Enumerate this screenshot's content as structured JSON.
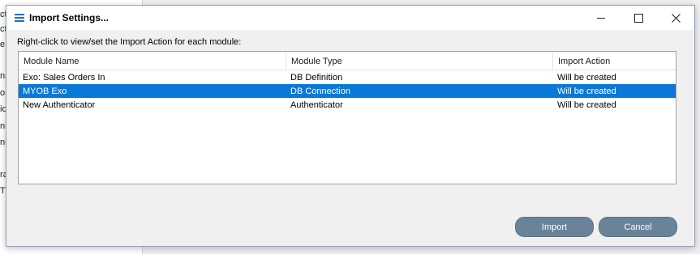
{
  "background": {
    "fragments": [
      "ct",
      "ct",
      "e",
      "ns",
      "or",
      "io",
      "ni",
      "ni",
      "ra",
      "T"
    ]
  },
  "dialog": {
    "title": "Import Settings...",
    "instruction": "Right-click to view/set the Import Action for each module:",
    "columns": [
      "Module Name",
      "Module Type",
      "Import Action"
    ],
    "rows": [
      {
        "name": "Exo: Sales Orders In",
        "type": "DB Definition",
        "action": "Will be created",
        "selected": false
      },
      {
        "name": "MYOB Exo",
        "type": "DB Connection",
        "action": "Will be created",
        "selected": true
      },
      {
        "name": "New Authenticator",
        "type": "Authenticator",
        "action": "Will be created",
        "selected": false
      }
    ],
    "import_label": "Import",
    "cancel_label": "Cancel",
    "selection_color": "#0a78d7",
    "button_color": "#6b8398"
  }
}
